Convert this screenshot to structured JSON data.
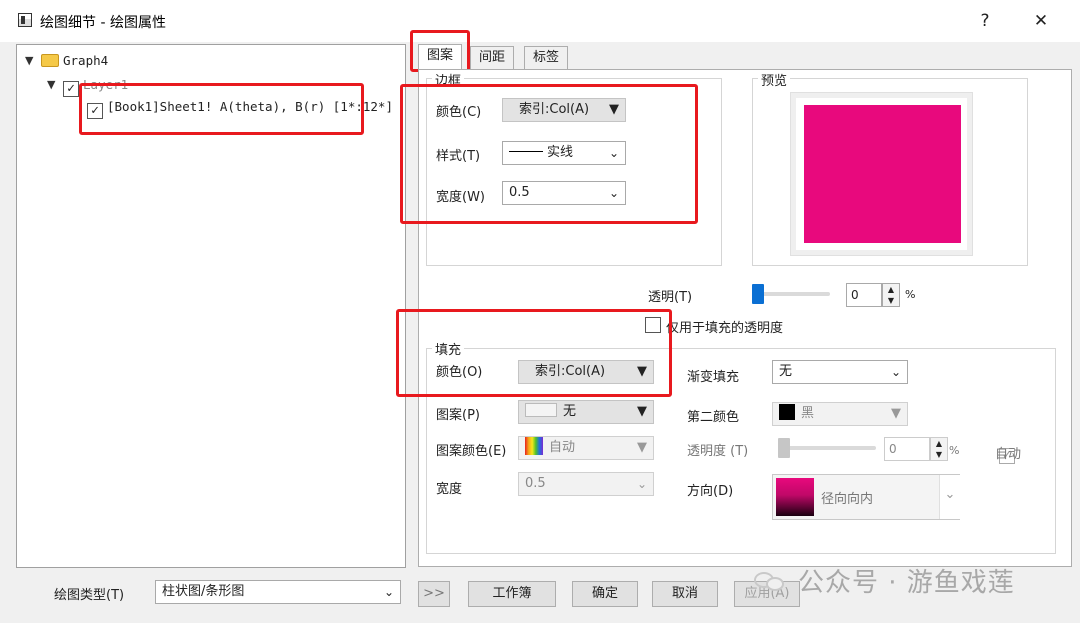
{
  "window": {
    "title": "绘图细节 - 绘图属性",
    "help": "?",
    "close": "✕"
  },
  "tree": {
    "graph": "Graph4",
    "layer": "Layer1",
    "plot": "[Book1]Sheet1! A(theta), B(r) [1*:12*]"
  },
  "tabs": [
    "图案",
    "间距",
    "标签"
  ],
  "border": {
    "group": "边框",
    "color_label": "颜色(C)",
    "color_value": "索引:Col(A)",
    "style_label": "样式(T)",
    "style_value": "实线",
    "width_label": "宽度(W)",
    "width_value": "0.5"
  },
  "preview": {
    "group": "预览",
    "color": "#e8097d"
  },
  "transparency": {
    "label": "透明(T)",
    "value": "0",
    "unit": "%",
    "fill_only_label": "仅用于填充的透明度",
    "level": 0
  },
  "fill": {
    "group": "填充",
    "color_label": "颜色(O)",
    "color_value": "索引:Col(A)",
    "pattern_label": "图案(P)",
    "pattern_value": "无",
    "pattern_color_label": "图案颜色(E)",
    "pattern_color_value": "自动",
    "width_label": "宽度",
    "width_value": "0.5",
    "gradient_label": "渐变填充",
    "gradient_value": "无",
    "second_color_label": "第二颜色",
    "second_color_value": "黑",
    "opacity_label": "透明度 (T)",
    "opacity_value": "0",
    "opacity_unit": "%",
    "auto_label": "自动",
    "direction_label": "方向(D)",
    "direction_value": "径向向内"
  },
  "footer": {
    "plot_type_label": "绘图类型(T)",
    "plot_type_value": "柱状图/条形图",
    "expand": ">>",
    "workbook": "工作簿",
    "ok": "确定",
    "cancel": "取消",
    "apply": "应用(A)"
  },
  "watermark": "公众号 · 游鱼戏莲",
  "colors": {
    "highlight": "#e8191e",
    "accent": "#0a6fd3",
    "swatch": "#e8097d"
  }
}
